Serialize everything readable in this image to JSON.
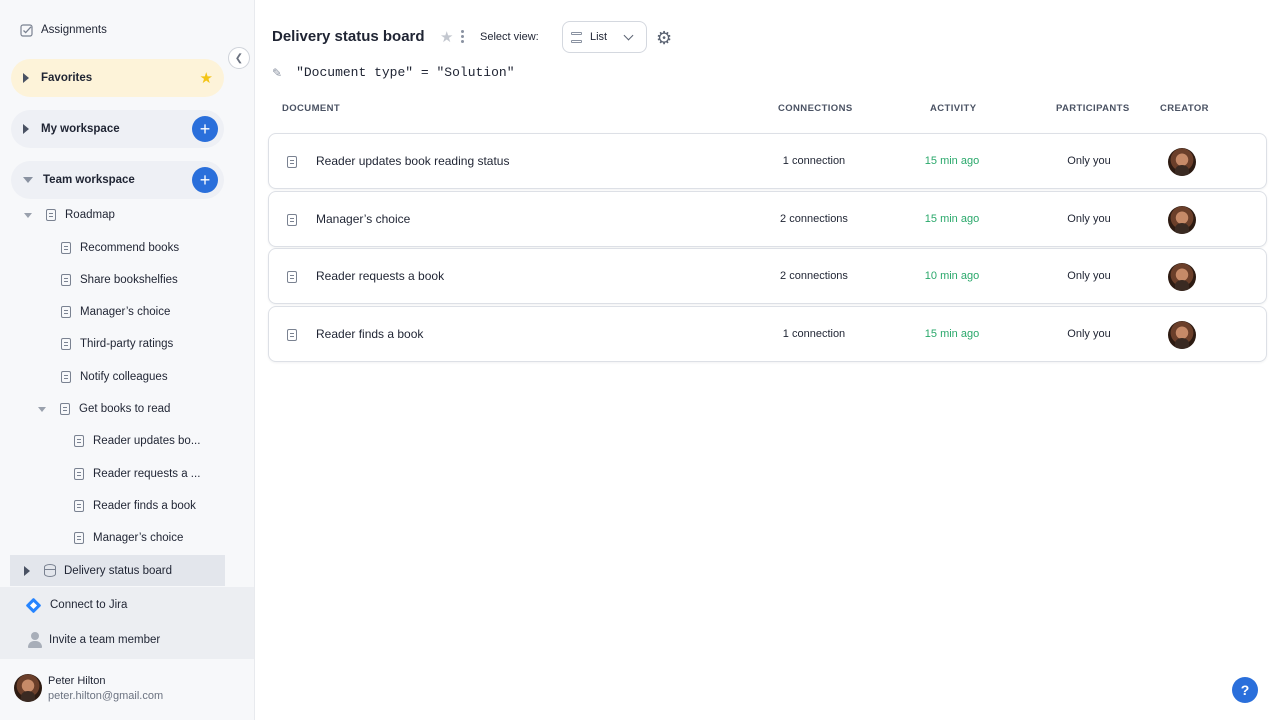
{
  "sidebar": {
    "assignments_label": "Assignments",
    "favorites_label": "Favorites",
    "my_workspace_label": "My workspace",
    "team_workspace_label": "Team workspace",
    "tree": [
      {
        "label": "Roadmap"
      },
      {
        "label": "Recommend books"
      },
      {
        "label": "Share bookshelfies"
      },
      {
        "label": "Manager’s choice"
      },
      {
        "label": "Third-party ratings"
      },
      {
        "label": "Notify colleagues"
      },
      {
        "label": "Get books to read"
      },
      {
        "label": "Reader updates bo..."
      },
      {
        "label": "Reader requests a ..."
      },
      {
        "label": "Reader finds a book"
      },
      {
        "label": "Manager’s choice"
      }
    ],
    "board_label": "Delivery status board",
    "connect_jira_label": "Connect to Jira",
    "invite_label": "Invite a team member",
    "user": {
      "name": "Peter Hilton",
      "email": "peter.hilton@gmail.com"
    }
  },
  "header": {
    "title": "Delivery status board",
    "select_view_label": "Select view:",
    "view_value": "List"
  },
  "filter": {
    "expression": "\"Document type\" = \"Solution\""
  },
  "table": {
    "columns": {
      "document": "DOCUMENT",
      "connections": "CONNECTIONS",
      "activity": "ACTIVITY",
      "participants": "PARTICIPANTS",
      "creator": "CREATOR"
    },
    "rows": [
      {
        "name": "Reader updates book reading status",
        "connections": "1 connection",
        "activity": "15 min ago",
        "participants": "Only you"
      },
      {
        "name": "Manager’s choice",
        "connections": "2 connections",
        "activity": "15 min ago",
        "participants": "Only you"
      },
      {
        "name": "Reader requests a book",
        "connections": "2 connections",
        "activity": "10 min ago",
        "participants": "Only you"
      },
      {
        "name": "Reader finds a book",
        "connections": "1 connection",
        "activity": "15 min ago",
        "participants": "Only you"
      }
    ]
  },
  "help_label": "?",
  "colors": {
    "accent": "#2a6fdb",
    "activity": "#2aa86b",
    "favorites_bg": "#fdf3d9",
    "star": "#f3c416"
  }
}
